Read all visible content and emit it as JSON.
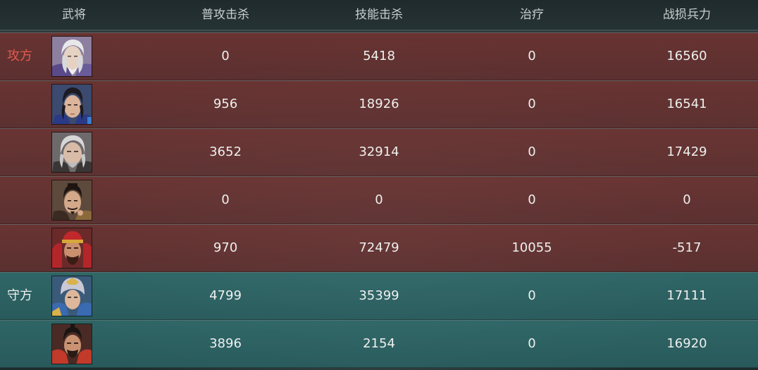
{
  "headers": {
    "general": "武将",
    "normal_kills": "普攻击杀",
    "skill_kills": "技能击杀",
    "healing": "治疗",
    "troop_loss": "战损兵力"
  },
  "sides": {
    "attack": {
      "label": "攻方",
      "color": "#e25a4e"
    },
    "defend": {
      "label": "守方",
      "color": "#eef0ef"
    }
  },
  "rows": [
    {
      "side": "attack",
      "portrait": "white-haired-elder-portrait",
      "normal_kills": "0",
      "skill_kills": "5418",
      "healing": "0",
      "troop_loss": "16560"
    },
    {
      "side": "attack",
      "portrait": "young-scholar-portrait",
      "normal_kills": "956",
      "skill_kills": "18926",
      "healing": "0",
      "troop_loss": "16541"
    },
    {
      "side": "attack",
      "portrait": "grey-haired-general-portrait",
      "normal_kills": "3652",
      "skill_kills": "32914",
      "healing": "0",
      "troop_loss": "17429"
    },
    {
      "side": "attack",
      "portrait": "bearded-strategist-portrait",
      "normal_kills": "0",
      "skill_kills": "0",
      "healing": "0",
      "troop_loss": "0"
    },
    {
      "side": "attack",
      "portrait": "red-headband-warrior-portrait",
      "normal_kills": "970",
      "skill_kills": "72479",
      "healing": "10055",
      "troop_loss": "-517"
    },
    {
      "side": "defend",
      "portrait": "armored-knight-portrait",
      "normal_kills": "4799",
      "skill_kills": "35399",
      "healing": "0",
      "troop_loss": "17111"
    },
    {
      "side": "defend",
      "portrait": "red-armored-general-portrait",
      "normal_kills": "3896",
      "skill_kills": "2154",
      "healing": "0",
      "troop_loss": "16920"
    }
  ]
}
